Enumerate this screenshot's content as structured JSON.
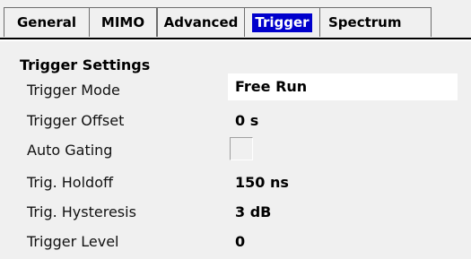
{
  "tabs": [
    {
      "label": "General",
      "active": false
    },
    {
      "label": "MIMO",
      "active": false
    },
    {
      "label": "Advanced",
      "active": false
    },
    {
      "label": "Trigger",
      "active": true
    },
    {
      "label": "Spectrum",
      "active": false
    }
  ],
  "colors": {
    "active_tab_bg": "#0000cc",
    "panel_bg": "#f0f0f0",
    "field_bg": "#ffffff"
  },
  "section": {
    "title": "Trigger Settings",
    "rows": [
      {
        "label": "Trigger Mode",
        "value": "Free Run"
      },
      {
        "label": "Trigger Offset",
        "value": "0 s"
      },
      {
        "label": "Auto Gating",
        "checked": false
      },
      {
        "label": "Trig. Holdoff",
        "value": "150 ns"
      },
      {
        "label": "Trig. Hysteresis",
        "value": "3 dB"
      },
      {
        "label": "Trigger Level",
        "value": "0"
      }
    ]
  }
}
